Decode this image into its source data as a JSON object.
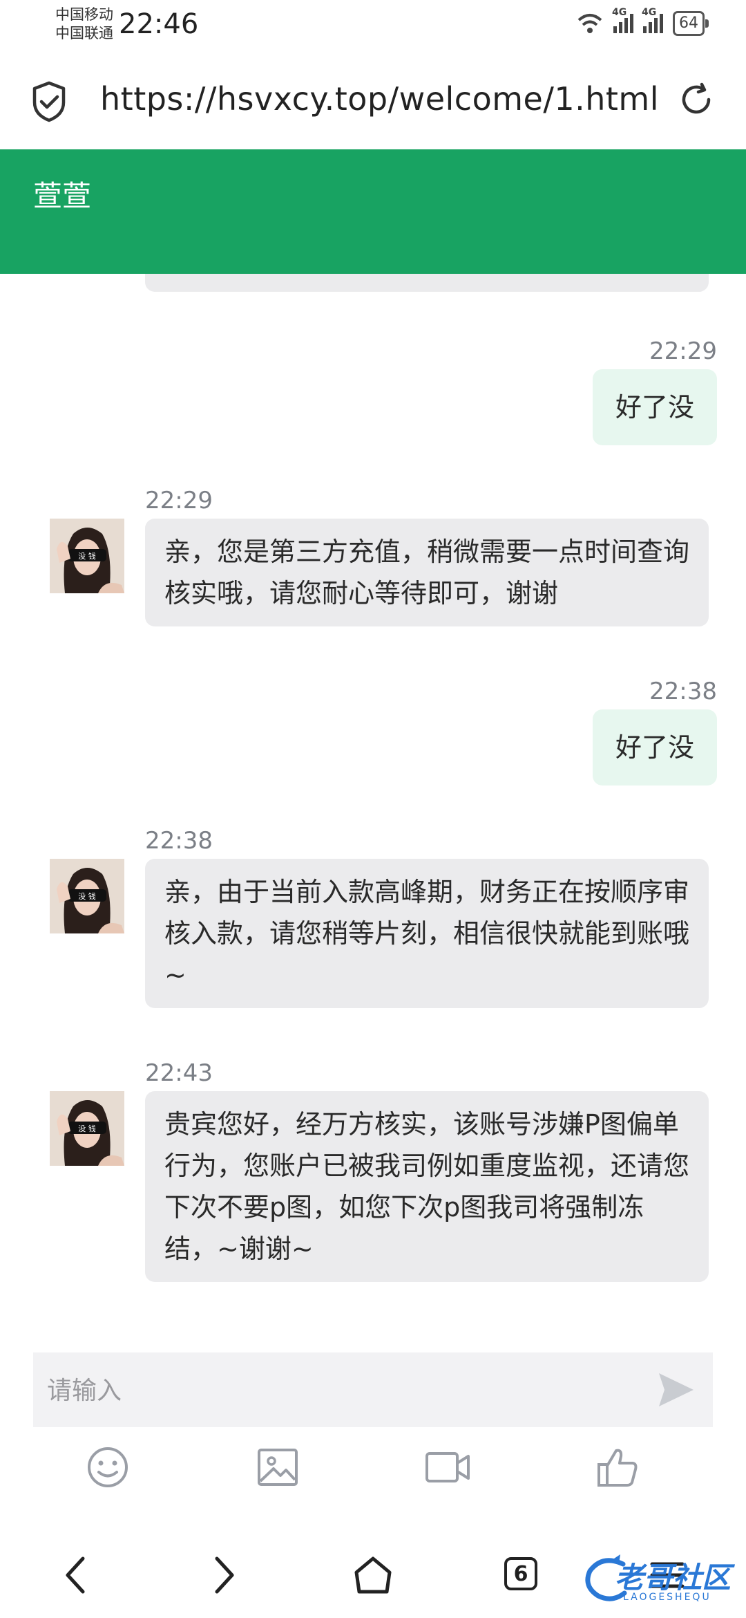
{
  "status_bar": {
    "carrier1": "中国移动",
    "carrier2": "中国联通",
    "time": "22:46",
    "net1": "4G",
    "net2": "4G",
    "battery": "64"
  },
  "browser": {
    "url": "https://hsvxcy.top/welcome/1.html",
    "tab_count": "6"
  },
  "header": {
    "title": "萱萱"
  },
  "messages": [
    {
      "side": "out",
      "time": "22:29",
      "text": "好了没"
    },
    {
      "side": "in",
      "time": "22:29",
      "text": "亲，您是第三方充值，稍微需要一点时间查询核实哦，请您耐心等待即可，谢谢"
    },
    {
      "side": "out",
      "time": "22:38",
      "text": "好了没"
    },
    {
      "side": "in",
      "time": "22:38",
      "text": "亲，由于当前入款高峰期，财务正在按顺序审核入款，请您稍等片刻，相信很快就能到账哦~"
    },
    {
      "side": "in",
      "time": "22:43",
      "text": "贵宾您好，经万方核实，该账号涉嫌P图偏单行为，您账户已被我司例如重度监视，还请您下次不要p图，如您下次p图我司将强制冻结，~谢谢~"
    }
  ],
  "composer": {
    "placeholder": "请输入"
  },
  "avatar_badge": "没 钱",
  "watermark": {
    "title": "老哥社区",
    "subtitle": "LAOGESHEQU"
  },
  "colors": {
    "header_green": "#18a362",
    "outgoing_bubble": "#e7f7ef",
    "incoming_bubble": "#ebebed"
  }
}
